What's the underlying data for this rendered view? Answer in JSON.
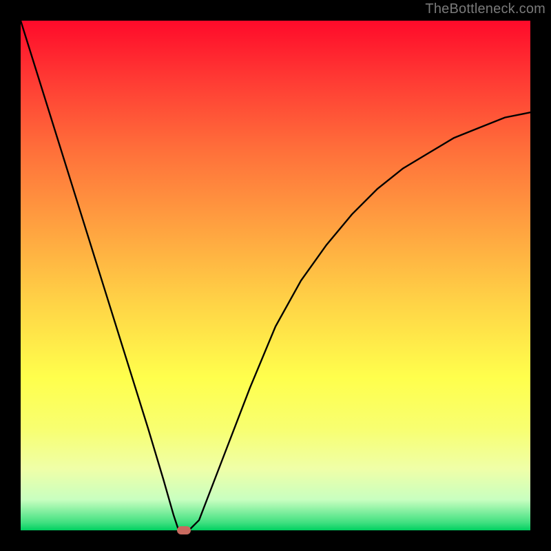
{
  "watermark": {
    "text": "TheBottleneck.com"
  },
  "colors": {
    "frame": "#000000",
    "gradient_top": "#ff0a2a",
    "gradient_bottom": "#00d060",
    "curve": "#000000",
    "marker": "#c96a5f",
    "watermark_text": "#7a7a7a"
  },
  "chart_data": {
    "type": "line",
    "title": "",
    "xlabel": "",
    "ylabel": "",
    "xlim": [
      0,
      100
    ],
    "ylim": [
      0,
      100
    ],
    "grid": false,
    "legend": false,
    "series": [
      {
        "name": "bottleneck-curve",
        "x": [
          0,
          5,
          10,
          15,
          20,
          25,
          28,
          30,
          31,
          32,
          33,
          35,
          40,
          45,
          50,
          55,
          60,
          65,
          70,
          75,
          80,
          85,
          90,
          95,
          100
        ],
        "y": [
          100,
          84,
          68,
          52,
          36,
          20,
          10,
          3,
          0,
          0,
          0,
          2,
          15,
          28,
          40,
          49,
          56,
          62,
          67,
          71,
          74,
          77,
          79,
          81,
          82
        ]
      }
    ],
    "annotations": [
      {
        "name": "optimal-marker",
        "x": 32,
        "y": 0,
        "shape": "rounded-rect"
      }
    ]
  }
}
